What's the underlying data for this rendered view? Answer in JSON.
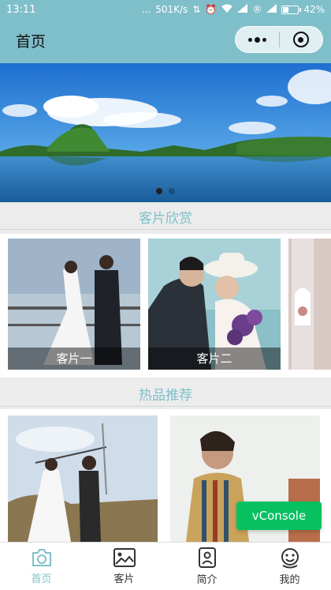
{
  "status_bar": {
    "time": "13:11",
    "dots": "...",
    "network_speed": "501K/s",
    "battery_percent": "42%",
    "battery_level": 0.42
  },
  "nav": {
    "title": "首页"
  },
  "banner": {
    "slide_count": 2,
    "active_index": 0
  },
  "sections": {
    "gallery_title": "客片欣赏",
    "hot_title": "热品推荐"
  },
  "gallery": {
    "items": [
      {
        "caption": "客片一"
      },
      {
        "caption": "客片二"
      }
    ]
  },
  "vconsole": {
    "label": "vConsole"
  },
  "tabs": [
    {
      "label": "首页",
      "icon": "camera-icon",
      "active": true
    },
    {
      "label": "客片",
      "icon": "image-icon",
      "active": false
    },
    {
      "label": "简介",
      "icon": "profile-icon",
      "active": false
    },
    {
      "label": "我的",
      "icon": "smiley-icon",
      "active": false
    }
  ],
  "colors": {
    "accent": "#7fbfca",
    "vconsole": "#07c160"
  }
}
